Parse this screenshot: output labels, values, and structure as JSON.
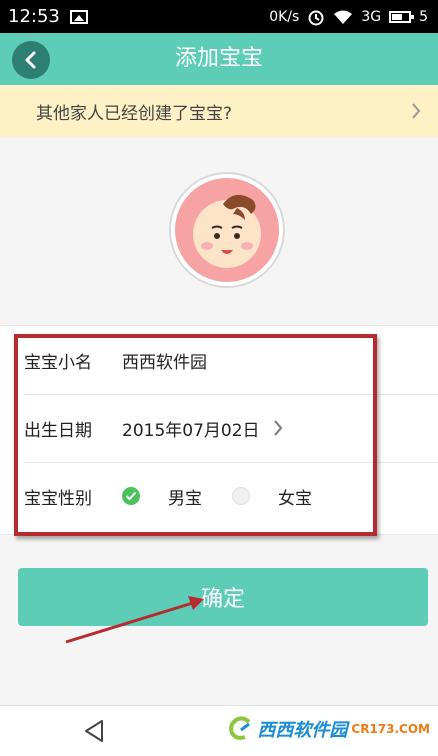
{
  "status_bar": {
    "time": "12:53",
    "speed": "0K/s",
    "network": "3G",
    "battery": "5"
  },
  "app_bar": {
    "title": "添加宝宝"
  },
  "notice": {
    "text": "其他家人已经创建了宝宝?"
  },
  "form": {
    "name_label": "宝宝小名",
    "name_value": "西西软件园",
    "birth_label": "出生日期",
    "birth_value": "2015年07月02日",
    "gender_label": "宝宝性别",
    "gender_options": [
      "男宝",
      "女宝"
    ],
    "gender_selected": "男宝"
  },
  "confirm_label": "确定",
  "watermark": {
    "main": "西西软件园",
    "sub": "CR173.COM"
  },
  "colors": {
    "accent": "#5ecdb8",
    "back_button": "#2d7f71",
    "notice_bg": "#fdf1c5",
    "annotation": "#b52b2f",
    "radio_checked": "#4cc25c"
  },
  "icons": {
    "back": "chevron-left-icon",
    "notice_chevron": "chevron-right-icon",
    "birth_chevron": "chevron-right-icon",
    "nav_back": "triangle-back-icon"
  }
}
